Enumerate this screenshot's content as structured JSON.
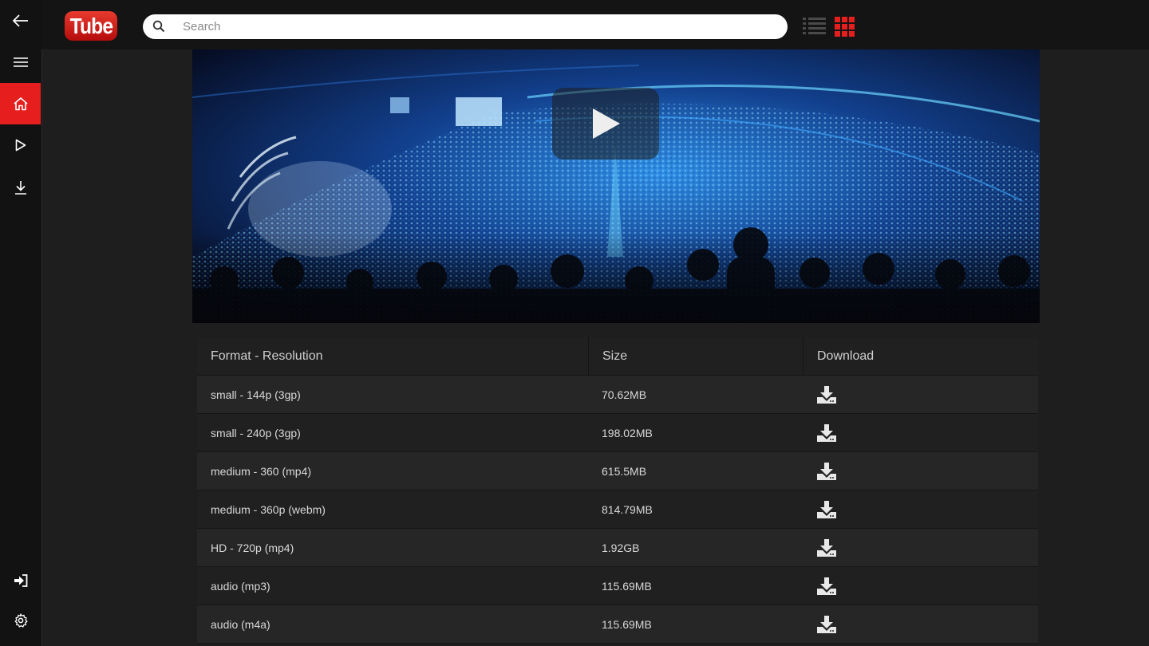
{
  "app": {
    "logo_text": "Tube",
    "brand_color": "#e61e1e"
  },
  "sidebar": {
    "items": [
      {
        "icon": "back-arrow-icon"
      },
      {
        "icon": "menu-icon"
      },
      {
        "icon": "home-icon",
        "active": true
      },
      {
        "icon": "play-icon"
      },
      {
        "icon": "download-icon"
      },
      {
        "icon": "sign-in-icon"
      },
      {
        "icon": "gear-icon"
      }
    ]
  },
  "search": {
    "placeholder": "Search",
    "value": ""
  },
  "view_toggle": {
    "list_icon": "list-view-icon",
    "grid_icon": "grid-view-icon",
    "active": "grid"
  },
  "video": {
    "thumbnail": "arena-concert-crowd-blue-lights",
    "play_icon": "play-icon"
  },
  "table": {
    "headers": [
      "Format - Resolution",
      "Size",
      "Download"
    ],
    "rows": [
      {
        "format": "small - 144p (3gp)",
        "size": "70.62MB"
      },
      {
        "format": "small - 240p (3gp)",
        "size": "198.02MB"
      },
      {
        "format": "medium - 360 (mp4)",
        "size": "615.5MB"
      },
      {
        "format": "medium - 360p (webm)",
        "size": "814.79MB"
      },
      {
        "format": "HD - 720p (mp4)",
        "size": "1.92GB"
      },
      {
        "format": "audio (mp3)",
        "size": "115.69MB"
      },
      {
        "format": "audio (m4a)",
        "size": "115.69MB"
      }
    ]
  }
}
